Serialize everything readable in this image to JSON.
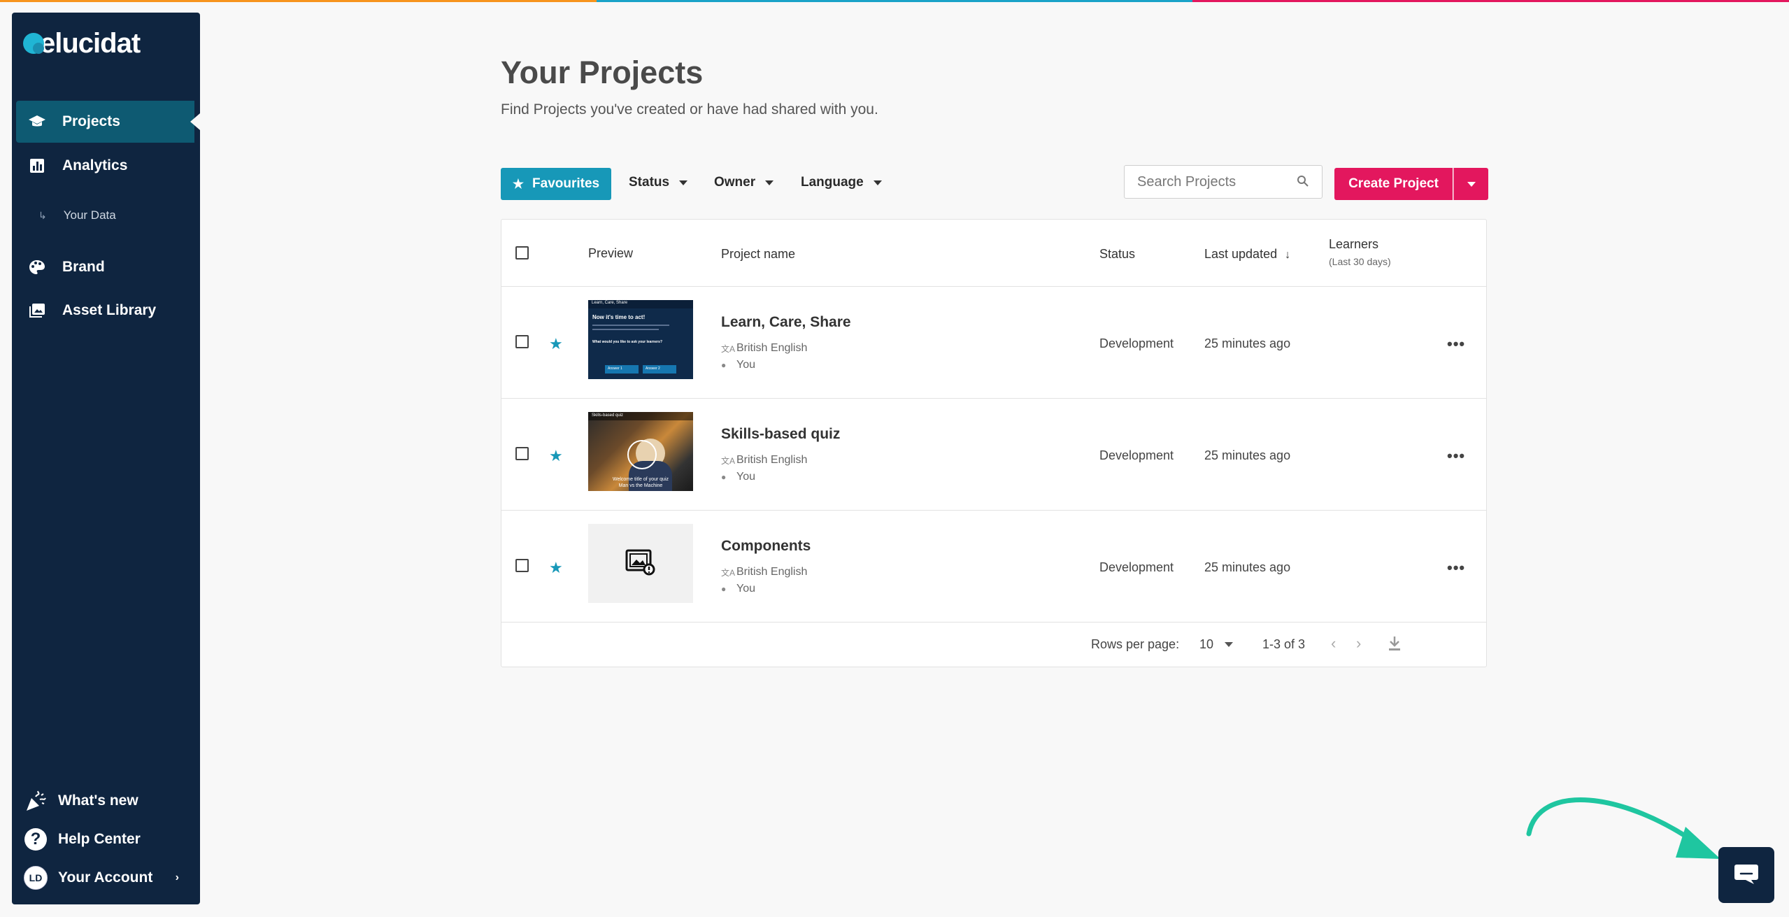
{
  "colors": {
    "top_bar": [
      "#f7941d",
      "#1aa3c8",
      "#e3175e"
    ],
    "sidebar_bg": "#0f2540",
    "accent": "#1798b8",
    "primary_button": "#e3175e",
    "annotation_arrow": "#1fc6a0"
  },
  "brand": {
    "logo_text": "elucidat"
  },
  "sidebar": {
    "nav": [
      {
        "label": "Projects",
        "icon": "graduation-cap-icon",
        "active": true
      },
      {
        "label": "Analytics",
        "icon": "bar-chart-icon",
        "active": false
      },
      {
        "label": "Brand",
        "icon": "palette-icon",
        "active": false
      },
      {
        "label": "Asset Library",
        "icon": "image-library-icon",
        "active": false
      }
    ],
    "sub_item": {
      "label": "Your Data",
      "icon": "arrow-return-icon"
    },
    "bottom": {
      "whats_new": "What's new",
      "help_center": "Help Center",
      "account": "Your Account",
      "avatar_initials": "LD",
      "help_glyph": "?"
    }
  },
  "header": {
    "title": "Your Projects",
    "subtitle": "Find Projects you've created or have had shared with you."
  },
  "toolbar": {
    "favourites": "Favourites",
    "filters": [
      "Status",
      "Owner",
      "Language"
    ],
    "search_placeholder": "Search Projects",
    "create_project": "Create Project"
  },
  "table": {
    "columns": {
      "preview": "Preview",
      "name": "Project name",
      "status": "Status",
      "last_updated": "Last updated",
      "sort_indicator": "↓",
      "learners": "Learners",
      "learners_sub": "(Last 30 days)"
    },
    "rows": [
      {
        "name": "Learn, Care, Share",
        "language": "British English",
        "owner": "You",
        "status": "Development",
        "updated": "25 minutes ago",
        "favourite": true,
        "preview": {
          "kind": "dark-slide",
          "title": "Learn, Care, Share",
          "heading": "Now it's time to act!",
          "question": "What would you like to ask your learners?",
          "answers": [
            "Answer 1",
            "Answer 2"
          ]
        }
      },
      {
        "name": "Skills-based quiz",
        "language": "British English",
        "owner": "You",
        "status": "Development",
        "updated": "25 minutes ago",
        "favourite": true,
        "preview": {
          "kind": "photo",
          "title": "Skills-based quiz",
          "caption_line1": "Welcome title of your quiz",
          "caption_line2": "Man vs the Machine"
        }
      },
      {
        "name": "Components",
        "language": "British English",
        "owner": "You",
        "status": "Development",
        "updated": "25 minutes ago",
        "favourite": true,
        "preview": {
          "kind": "placeholder"
        }
      }
    ],
    "footer": {
      "rows_per_page_label": "Rows per page:",
      "rows_per_page": "10",
      "range": "1-3 of 3"
    }
  }
}
